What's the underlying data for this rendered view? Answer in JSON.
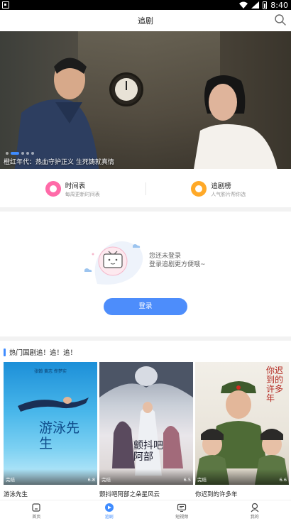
{
  "status_bar": {
    "time": "8:40"
  },
  "header": {
    "title": "追剧"
  },
  "banner": {
    "caption": "橙红年代：热血守护正义 生死铸就真情",
    "dot_count": 5,
    "active_dot": 1
  },
  "quick_links": [
    {
      "title": "时间表",
      "subtitle": "每周更新时间表",
      "color": "#ff6aa8"
    },
    {
      "title": "追剧榜",
      "subtitle": "人气影片帮你选",
      "color": "#ffa928"
    }
  ],
  "login": {
    "message_line1": "您还未登录",
    "message_line2": "登录追剧更方便哦~",
    "button_label": "登录"
  },
  "section": {
    "title": "热门国剧追！追！追！"
  },
  "dramas": [
    {
      "name": "游泳先生",
      "tag": "完结",
      "score": "6.8",
      "poster_title": "游泳先生",
      "poster_top_text": "张翰 黄志 佟梦实"
    },
    {
      "name": "颤抖吧阿部之朵星风云",
      "tag": "完结",
      "score": "6.5",
      "poster_title": "颤抖吧阿部"
    },
    {
      "name": "你迟到的许多年",
      "tag": "完结",
      "score": "6.6",
      "poster_title": "你迟到的许多年"
    }
  ],
  "tabbar": [
    {
      "label": "首页",
      "active": false
    },
    {
      "label": "追剧",
      "active": true
    },
    {
      "label": "短视频",
      "active": false
    },
    {
      "label": "我的",
      "active": false
    }
  ],
  "colors": {
    "accent": "#3f8cff",
    "login_button": "#4d8dfb"
  }
}
